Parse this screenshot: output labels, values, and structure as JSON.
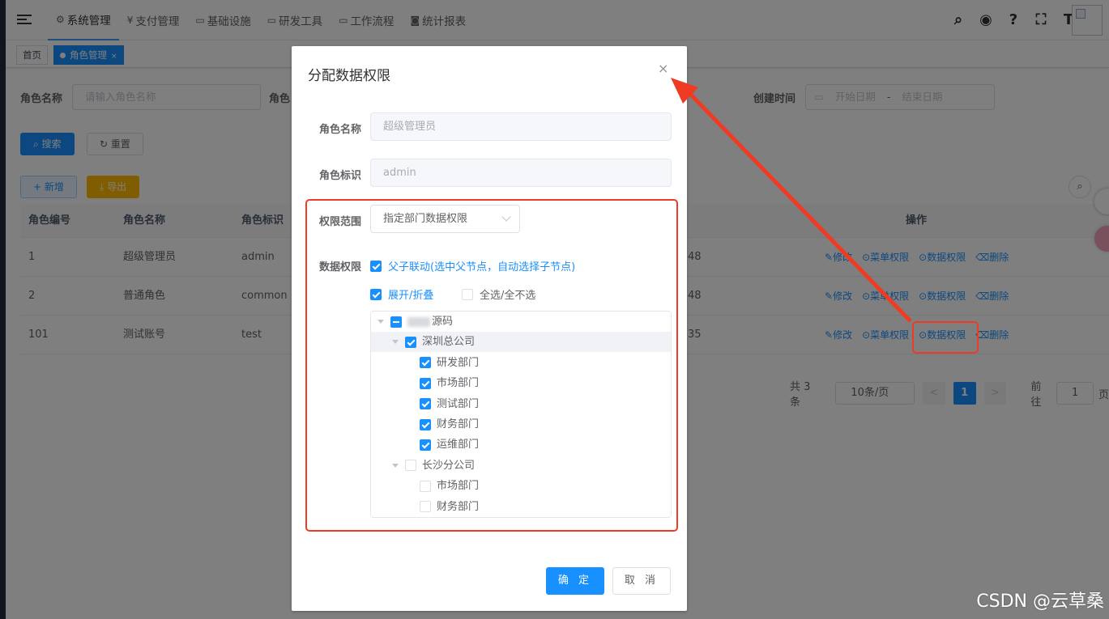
{
  "navbar": {
    "menus": [
      {
        "icon": "⚙",
        "label": "系统管理",
        "active": true
      },
      {
        "icon": "¥",
        "label": "支付管理"
      },
      {
        "icon": "▭",
        "label": "基础设施"
      },
      {
        "icon": "▭",
        "label": "研发工具"
      },
      {
        "icon": "▭",
        "label": "工作流程"
      },
      {
        "icon": "◙",
        "label": "统计报表"
      }
    ]
  },
  "tags": {
    "home": "首页",
    "active": "角色管理",
    "close": "×"
  },
  "search_form": {
    "role_name_label": "角色名称",
    "role_name_placeholder": "请输入角色名称",
    "role_key_label_partial": "角色",
    "created_label": "创建时间",
    "start_placeholder": "开始日期",
    "range_sep": "-",
    "end_placeholder": "结束日期",
    "search_btn": "搜索",
    "reset_btn": "重置",
    "add_btn": "新增",
    "export_btn": "导出"
  },
  "table": {
    "headers": [
      "角色编号",
      "角色名称",
      "角色标识",
      "操作"
    ],
    "rows": [
      {
        "id": "1",
        "name": "超级管理员",
        "key": "admin",
        "time_tail": "48"
      },
      {
        "id": "2",
        "name": "普通角色",
        "key": "common",
        "time_tail": "48"
      },
      {
        "id": "101",
        "name": "测试账号",
        "key": "test",
        "time_tail": "35"
      }
    ],
    "ops": [
      "修改",
      "菜单权限",
      "数据权限",
      "删除"
    ]
  },
  "pagination": {
    "total": "共 3 条",
    "page_size": "10条/页",
    "prev": "<",
    "current": "1",
    "next": ">",
    "goto_label": "前往",
    "goto_value": "1",
    "page_suffix": "页"
  },
  "dialog": {
    "title": "分配数据权限",
    "close": "×",
    "role_name_label": "角色名称",
    "role_name_value": "超级管理员",
    "role_key_label": "角色标识",
    "role_key_value": "admin",
    "scope_label": "权限范围",
    "scope_value": "指定部门数据权限",
    "data_perm_label": "数据权限",
    "opt_linkage": "父子联动(选中父节点，自动选择子节点)",
    "opt_expand": "展开/折叠",
    "opt_select_all": "全选/全不选",
    "tree": [
      {
        "label": "源码",
        "level": 0,
        "state": "half",
        "caret": true
      },
      {
        "label": "深圳总公司",
        "level": 1,
        "state": "on",
        "caret": true
      },
      {
        "label": "研发部门",
        "level": 2,
        "state": "on"
      },
      {
        "label": "市场部门",
        "level": 2,
        "state": "on"
      },
      {
        "label": "测试部门",
        "level": 2,
        "state": "on"
      },
      {
        "label": "财务部门",
        "level": 2,
        "state": "on"
      },
      {
        "label": "运维部门",
        "level": 2,
        "state": "on"
      },
      {
        "label": "长沙分公司",
        "level": 1,
        "state": "off",
        "caret": true
      },
      {
        "label": "市场部门",
        "level": 2,
        "state": "off"
      },
      {
        "label": "财务部门",
        "level": 2,
        "state": "off"
      }
    ],
    "ok_btn": "确 定",
    "cancel_btn": "取 消"
  },
  "watermark": "CSDN @云草桑",
  "colors": {
    "primary": "#1890ff",
    "warning": "#ffba00",
    "annotation_red": "#ef3b24"
  }
}
